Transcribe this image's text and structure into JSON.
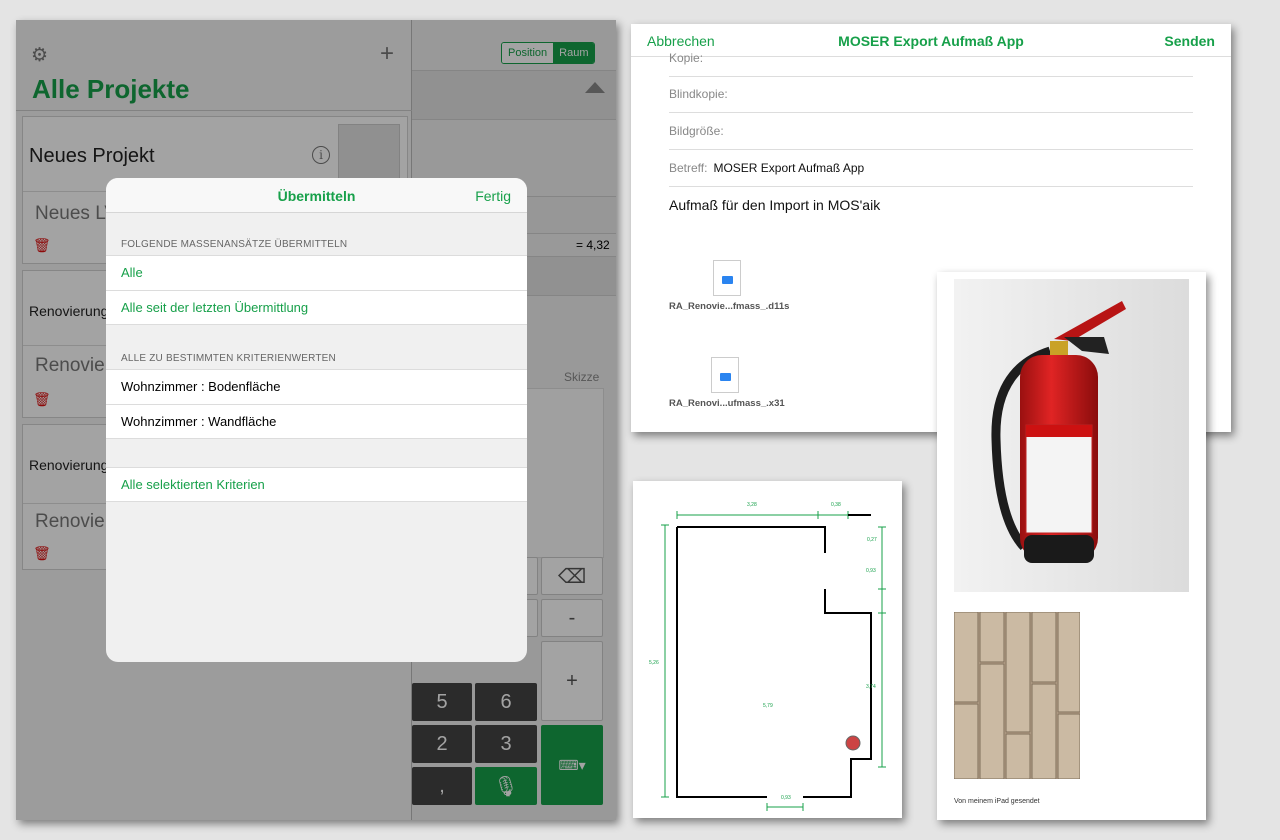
{
  "ipad": {
    "segment": [
      "Position",
      "Raum"
    ],
    "title": "Alle Projekte",
    "projects": [
      {
        "name": "Neues Projekt",
        "sub": "Neues LV"
      },
      {
        "name": "Renovierung",
        "sub": "Renovier"
      },
      {
        "name": "Renovierung",
        "sub": "Renovier"
      }
    ],
    "formula": "= 4,32",
    "sketch_label": "Skizze",
    "keys": [
      "5",
      "6",
      "2",
      "3",
      ",",
      "-",
      "+"
    ],
    "dialog": {
      "title": "Übermitteln",
      "done": "Fertig",
      "section1": "FOLGENDE MASSENANSÄTZE ÜBERMITTELN",
      "opt_all": "Alle",
      "opt_since": "Alle seit der letzten Übermittlung",
      "section2": "ALLE ZU BESTIMMTEN KRITERIENWERTEN",
      "crit1": "Wohnzimmer : Bodenfläche",
      "crit2": "Wohnzimmer : Wandfläche",
      "opt_selected": "Alle selektierten Kriterien"
    }
  },
  "mail": {
    "cancel": "Abbrechen",
    "title": "MOSER Export Aufmaß App",
    "send": "Senden",
    "fields": {
      "kopie": "Kopie:",
      "blindkopie": "Blindkopie:",
      "bildgroesse": "Bildgröße:",
      "betreff_label": "Betreff:",
      "betreff_value": "MOSER Export Aufmaß App"
    },
    "body": "Aufmaß für den Import in MOS'aik",
    "attachments": [
      "RA_Renovie...fmass_.d11s",
      "RA_Renovi...ufmass_.x31"
    ]
  },
  "plan": {
    "dims": [
      "3,28",
      "0,38",
      "0,27",
      "0,93",
      "5,26",
      "5,79",
      "3,74",
      "0,93"
    ]
  },
  "photos": {
    "signature": "Von meinem iPad gesendet"
  }
}
